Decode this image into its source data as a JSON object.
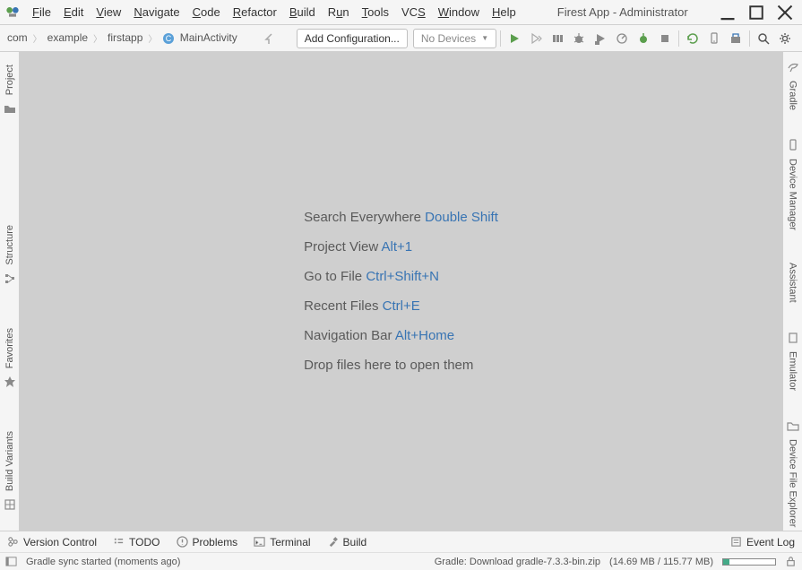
{
  "menu": [
    "File",
    "Edit",
    "View",
    "Navigate",
    "Code",
    "Refactor",
    "Build",
    "Run",
    "Tools",
    "VCS",
    "Window",
    "Help"
  ],
  "window_title": "Firest App - Administrator",
  "breadcrumb": {
    "items": [
      "com",
      "example",
      "firstapp",
      "MainActivity"
    ]
  },
  "toolbar": {
    "add_config": "Add Configuration...",
    "no_devices": "No Devices"
  },
  "left_tabs": {
    "project": "Project",
    "structure": "Structure",
    "favorites": "Favorites",
    "build_variants": "Build Variants"
  },
  "right_tabs": {
    "gradle": "Gradle",
    "device_manager": "Device Manager",
    "assistant": "Assistant",
    "emulator": "Emulator",
    "device_file_explorer": "Device File Explorer"
  },
  "hints": [
    {
      "label": "Search Everywhere ",
      "shortcut": "Double Shift"
    },
    {
      "label": "Project View ",
      "shortcut": "Alt+1"
    },
    {
      "label": "Go to File ",
      "shortcut": "Ctrl+Shift+N"
    },
    {
      "label": "Recent Files ",
      "shortcut": "Ctrl+E"
    },
    {
      "label": "Navigation Bar ",
      "shortcut": "Alt+Home"
    },
    {
      "label": "Drop files here to open them",
      "shortcut": ""
    }
  ],
  "bottom": {
    "version_control": "Version Control",
    "todo": "TODO",
    "problems": "Problems",
    "terminal": "Terminal",
    "build": "Build",
    "event_log": "Event Log"
  },
  "status": {
    "left": "Gradle sync started (moments ago)",
    "mid": "Gradle: Download gradle-7.3.3-bin.zip",
    "size": "(14.69 MB / 115.77 MB)"
  }
}
